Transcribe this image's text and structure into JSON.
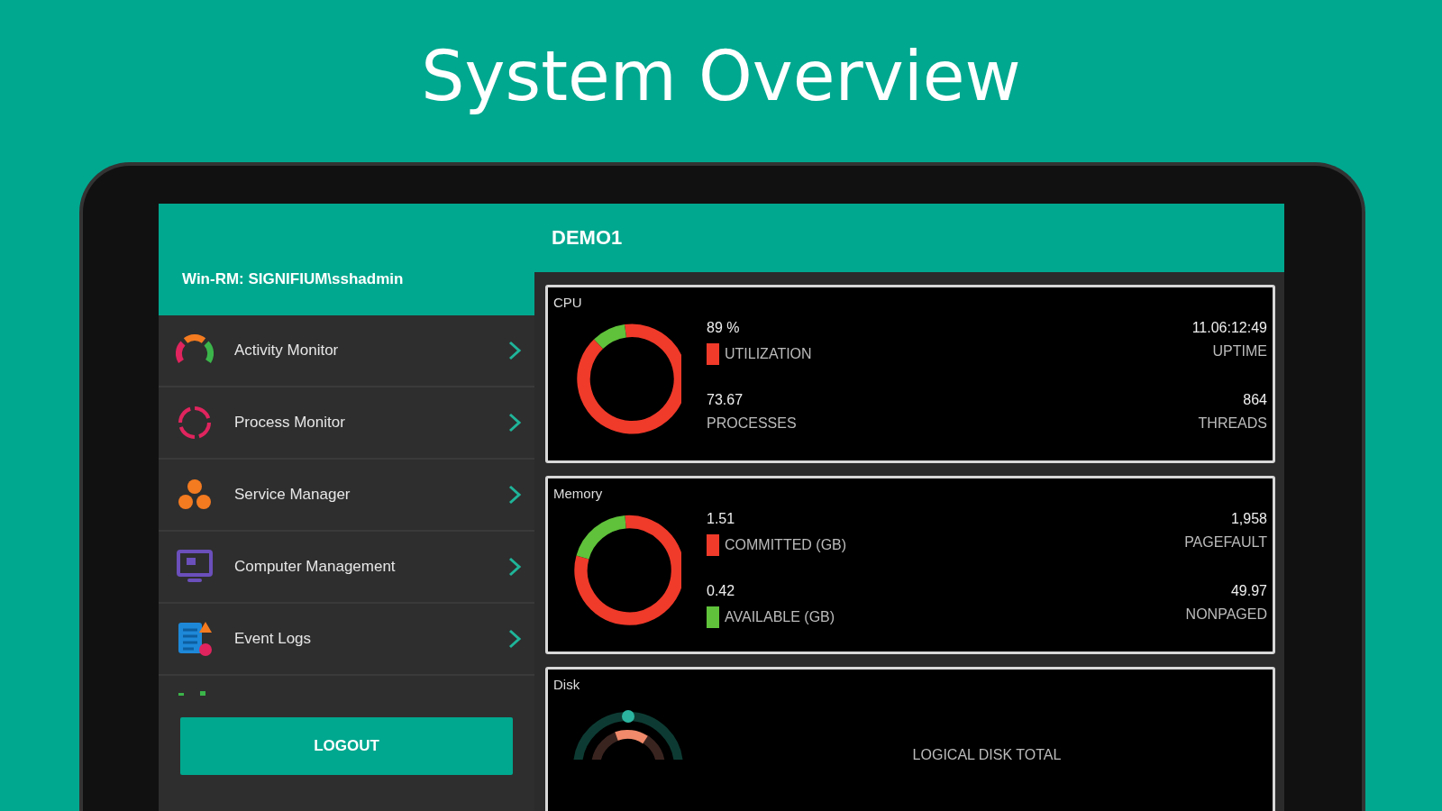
{
  "banner": {
    "title": "System Overview"
  },
  "sidebar": {
    "account": "Win-RM: SIGNIFIUM\\sshadmin",
    "items": [
      {
        "label": "Activity Monitor",
        "kind": "gauge"
      },
      {
        "label": "Process Monitor",
        "kind": "cycle"
      },
      {
        "label": "Service Manager",
        "kind": "cluster"
      },
      {
        "label": "Computer Management",
        "kind": "monitor"
      },
      {
        "label": "Event Logs",
        "kind": "logs"
      }
    ],
    "logout": "LOGOUT"
  },
  "header": {
    "title": "DEMO1"
  },
  "cards": [
    {
      "title": "CPU",
      "kind": "cpu",
      "stats": [
        {
          "value": "89 %",
          "label": "UTILIZATION",
          "color": "#f03a2a"
        },
        {
          "value": "11.06:12:49",
          "label": "UPTIME"
        },
        {
          "value": "73.67",
          "label": "PROCESSES"
        },
        {
          "value": "864",
          "label": "THREADS"
        }
      ]
    },
    {
      "title": "Memory",
      "kind": "memory",
      "stats": [
        {
          "value": "1.51",
          "label": "COMMITTED (GB)",
          "color": "#f03a2a"
        },
        {
          "value": "1,958",
          "label": "PAGEFAULT"
        },
        {
          "value": "0.42",
          "label": "AVAILABLE (GB)",
          "color": "#5fc23a"
        },
        {
          "value": "49.97",
          "label": "NONPAGED"
        }
      ]
    },
    {
      "title": "Disk",
      "kind": "disk",
      "caption": "LOGICAL DISK TOTAL"
    }
  ]
}
